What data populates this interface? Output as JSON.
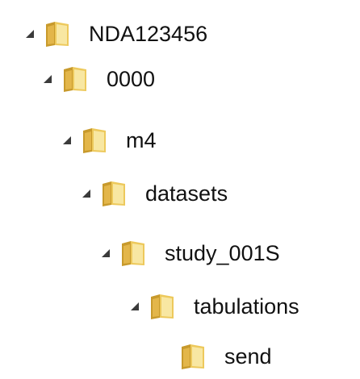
{
  "tree": {
    "nodes": [
      {
        "label": "NDA123456",
        "expanded": true,
        "has_children": true
      },
      {
        "label": "0000",
        "expanded": true,
        "has_children": true
      },
      {
        "label": "m4",
        "expanded": true,
        "has_children": true
      },
      {
        "label": "datasets",
        "expanded": true,
        "has_children": true
      },
      {
        "label": "study_001S",
        "expanded": true,
        "has_children": true
      },
      {
        "label": "tabulations",
        "expanded": true,
        "has_children": true
      },
      {
        "label": "send",
        "expanded": false,
        "has_children": false
      }
    ]
  },
  "icons": {
    "expander": "expanded-triangle-icon",
    "folder": "folder-icon"
  },
  "colors": {
    "expander": "#3b3b3b",
    "folder_light": "#f8e7a2",
    "folder_mid": "#edc95c",
    "folder_dark": "#c89a2c",
    "text": "#111111"
  }
}
